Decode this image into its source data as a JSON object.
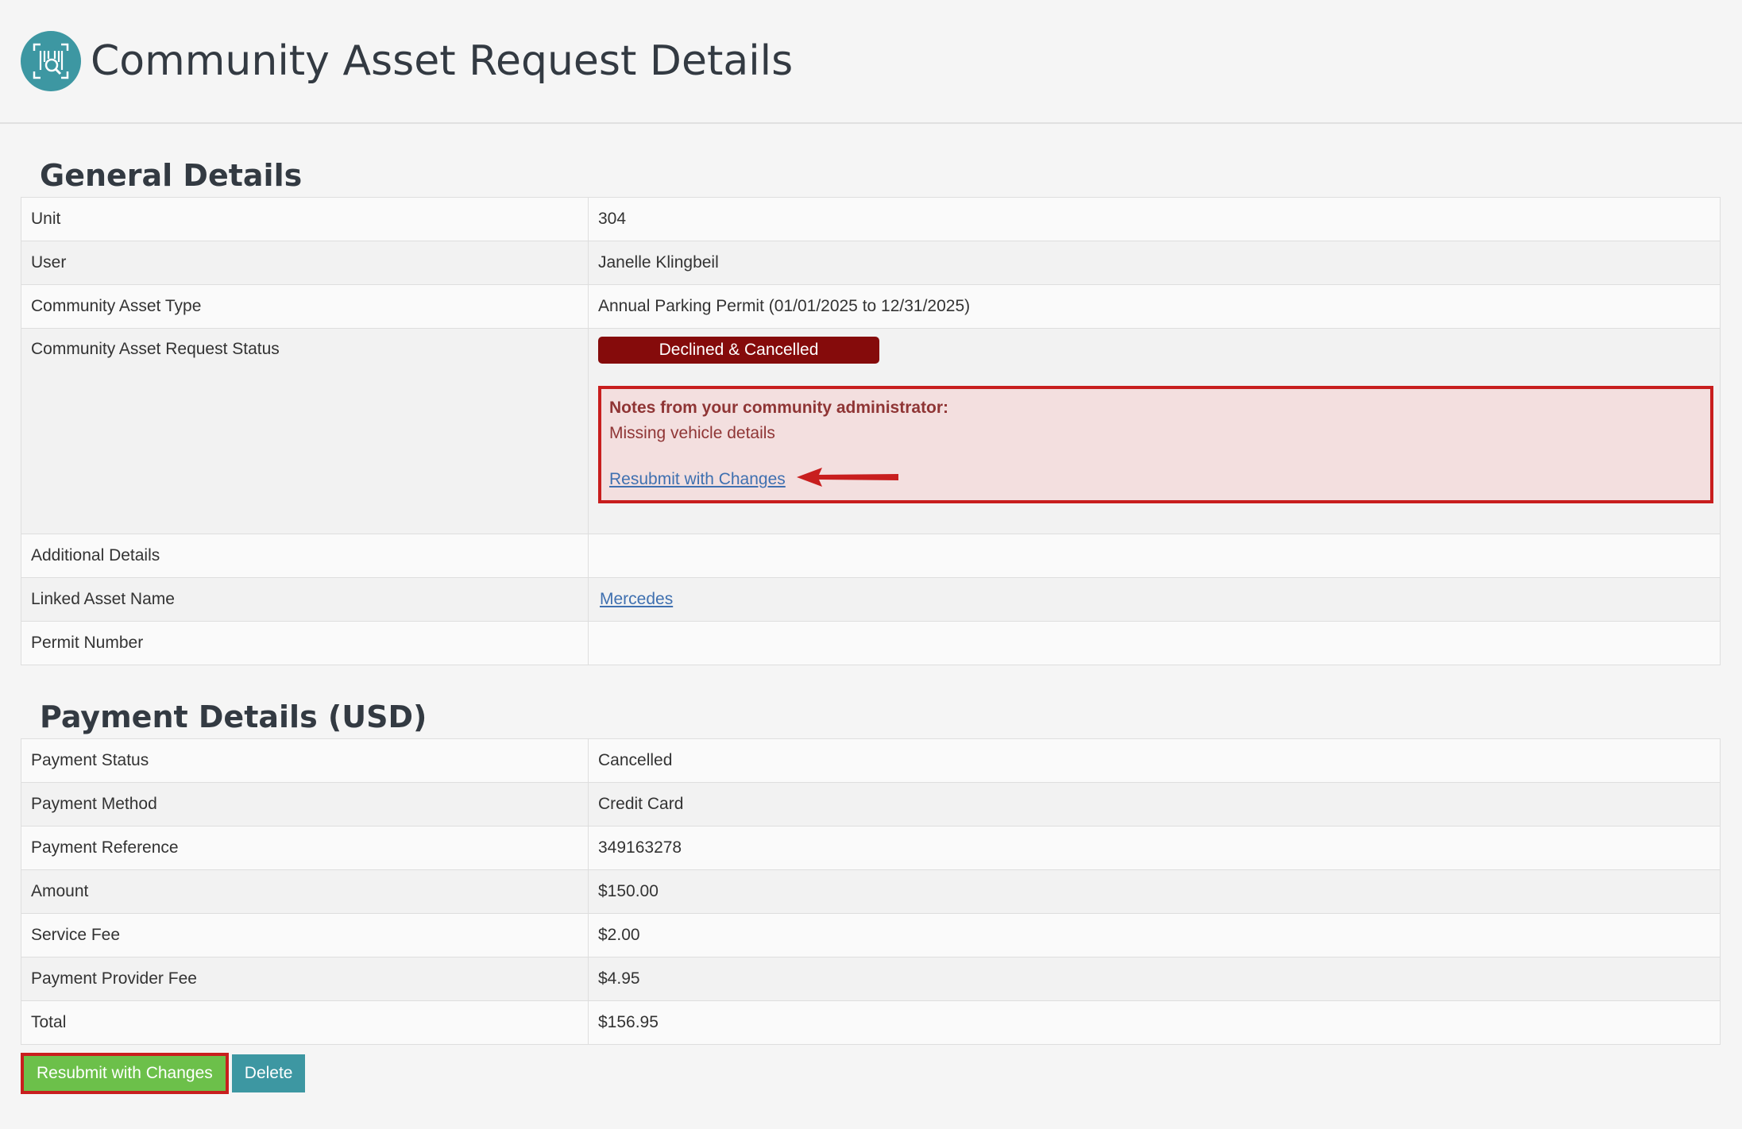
{
  "header": {
    "title": "Community Asset Request Details",
    "logo_icon": "barcode-search-icon"
  },
  "general": {
    "title": "General Details",
    "rows": [
      {
        "label": "Unit",
        "value": "304"
      },
      {
        "label": "User",
        "value": "Janelle Klingbeil"
      },
      {
        "label": "Community Asset Type",
        "value": "Annual Parking Permit (01/01/2025 to 12/31/2025)"
      },
      {
        "label": "Community Asset Request Status"
      },
      {
        "label": "Additional Details",
        "value": ""
      },
      {
        "label": "Linked Asset Name",
        "value": "Mercedes"
      },
      {
        "label": "Permit Number",
        "value": ""
      }
    ],
    "status": {
      "badge": "Declined & Cancelled",
      "badge_color": "#850b0b",
      "notes_title": "Notes from your community administrator:",
      "notes_text": "Missing vehicle details",
      "resubmit_link": "Resubmit with Changes"
    }
  },
  "payment": {
    "title": "Payment Details (USD)",
    "rows": [
      {
        "label": "Payment Status",
        "value": "Cancelled"
      },
      {
        "label": "Payment Method",
        "value": "Credit Card"
      },
      {
        "label": "Payment Reference",
        "value": "349163278"
      },
      {
        "label": "Amount",
        "value": "$150.00"
      },
      {
        "label": "Service Fee",
        "value": "$2.00"
      },
      {
        "label": "Payment Provider Fee",
        "value": "$4.95"
      },
      {
        "label": "Total",
        "value": "$156.95"
      }
    ]
  },
  "actions": {
    "resubmit_label": "Resubmit with Changes",
    "delete_label": "Delete"
  },
  "colors": {
    "accent": "#3d97a2",
    "success": "#6cc04a",
    "highlight": "#c81e1e"
  }
}
